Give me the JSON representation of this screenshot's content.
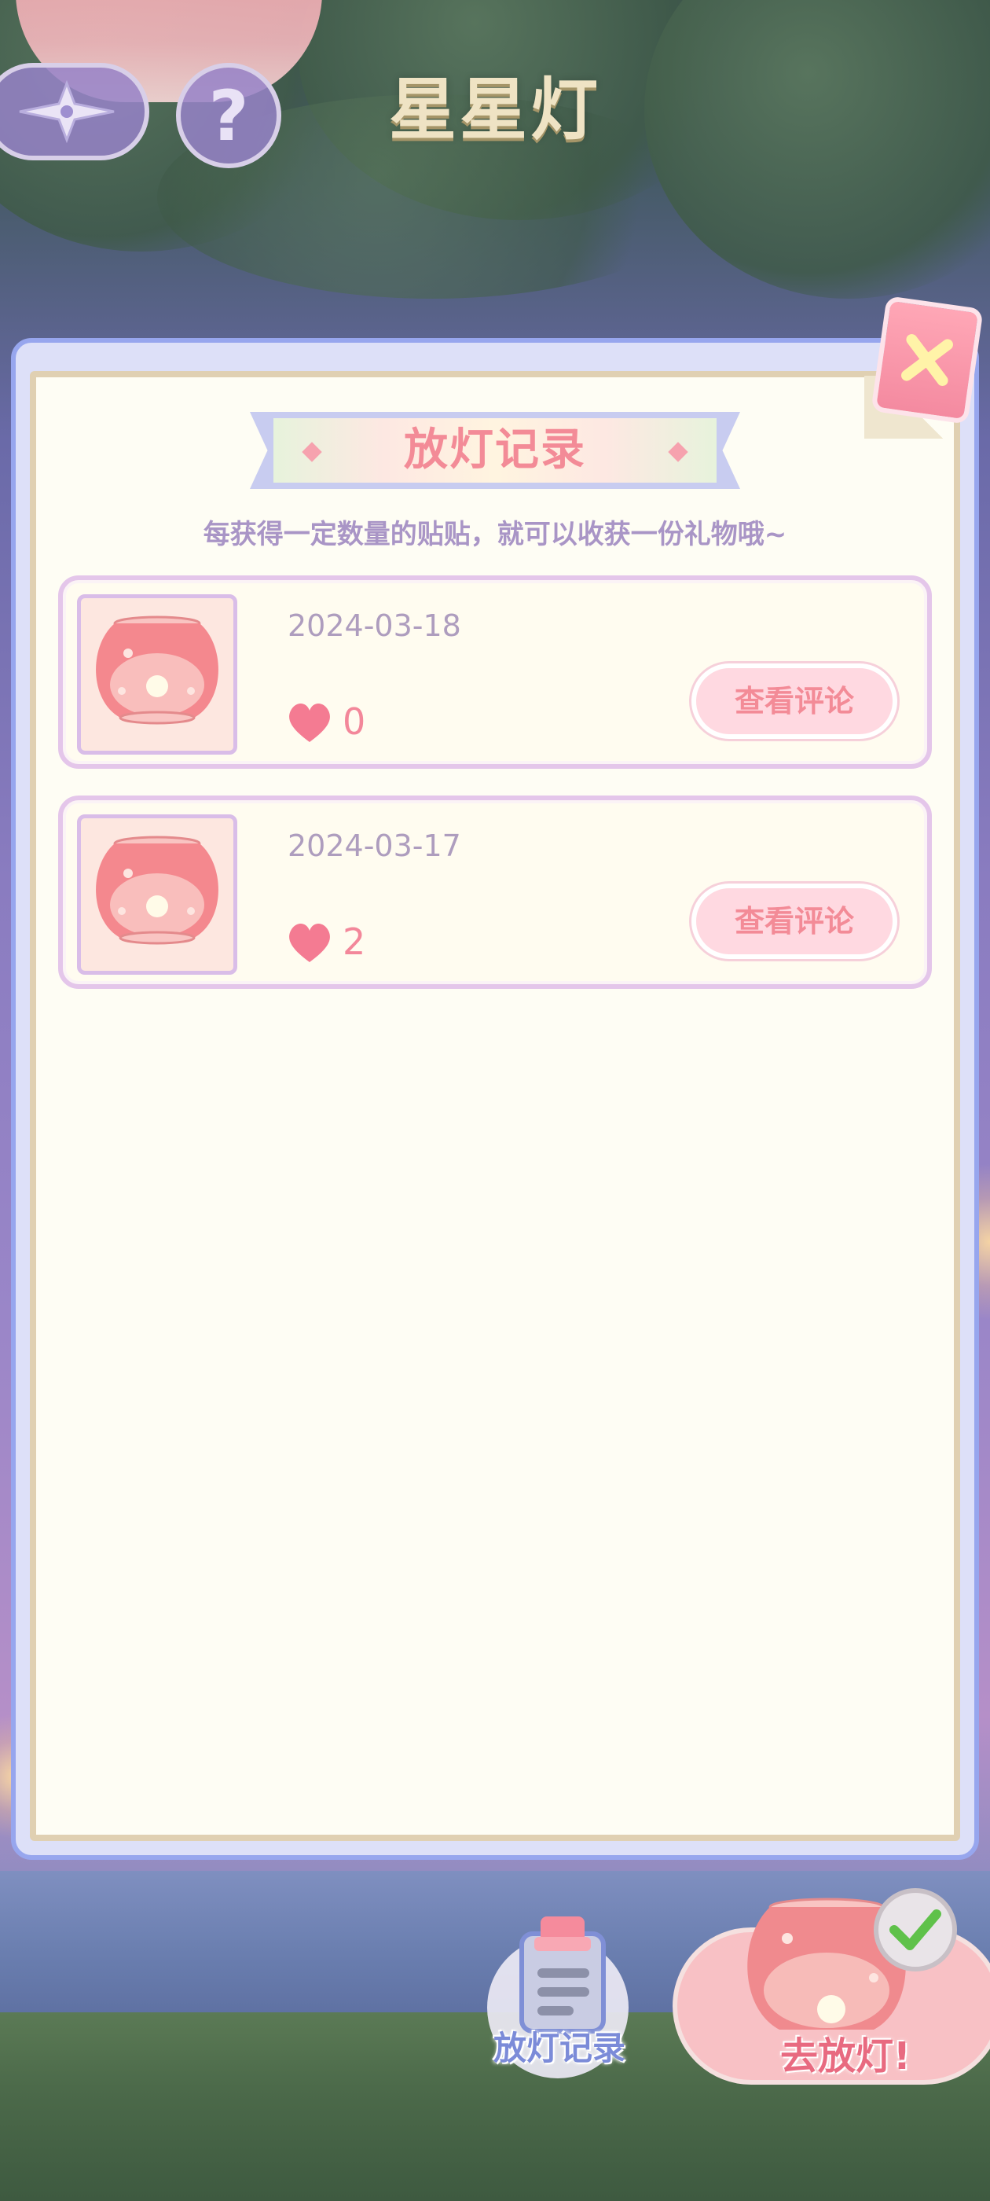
{
  "header": {
    "title": "星星灯",
    "help_glyph": "?"
  },
  "panel": {
    "title": "放灯记录",
    "subtitle": "每获得一定数量的贴贴，就可以收获一份礼物哦~"
  },
  "records": [
    {
      "date": "2024-03-18",
      "likes": "0",
      "button_label": "查看评论"
    },
    {
      "date": "2024-03-17",
      "likes": "2",
      "button_label": "查看评论"
    }
  ],
  "bottom": {
    "record_label": "放灯记录",
    "go_label": "去放灯!"
  },
  "icons": {
    "back": "sparkle-back-icon",
    "help": "question-icon",
    "close": "close-icon",
    "heart": "heart-icon",
    "lantern": "lantern-icon",
    "clipboard": "clipboard-icon",
    "check": "check-icon"
  },
  "colors": {
    "accent_pink": "#f38b97",
    "panel_border": "#97a6ee",
    "title_cream": "#efe3c4"
  }
}
